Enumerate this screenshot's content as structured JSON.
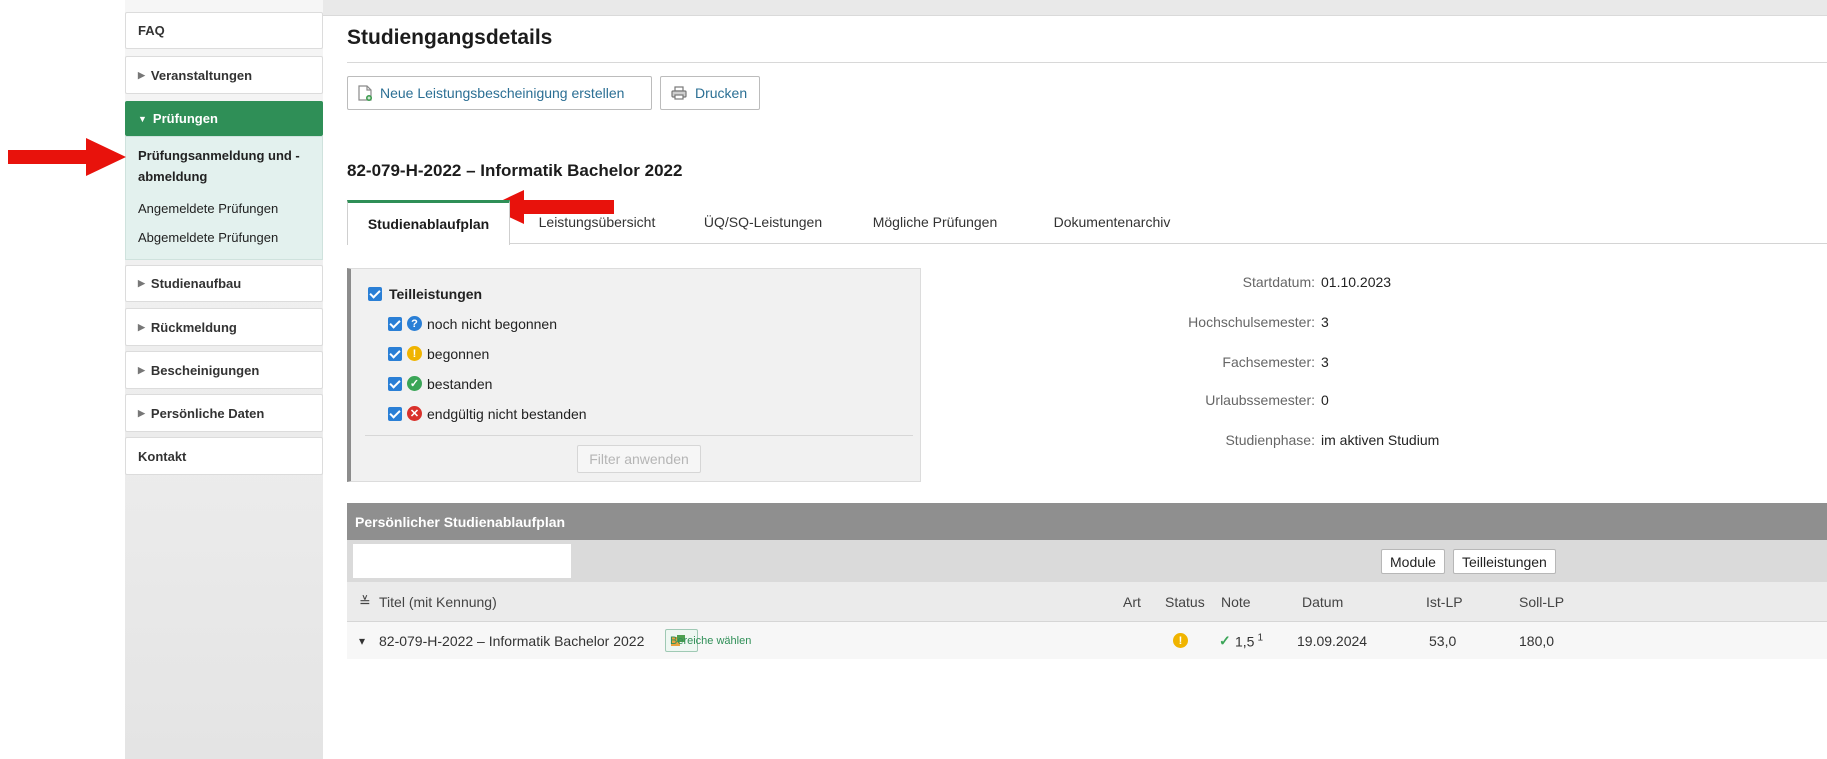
{
  "sidebar": {
    "faq": "FAQ",
    "veranstaltungen": "Veranstaltungen",
    "pruefungen": "Prüfungen",
    "sub": {
      "anmeldung": "Prüfungsanmeldung und -abmeldung",
      "angemeldete": "Angemeldete Prüfungen",
      "abgemeldete": "Abgemeldete Prüfungen"
    },
    "studienaufbau": "Studienaufbau",
    "rueckmeldung": "Rückmeldung",
    "bescheinigungen": "Bescheinigungen",
    "persoenliche_daten": "Persönliche Daten",
    "kontakt": "Kontakt"
  },
  "page": {
    "title": "Studiengangsdetails",
    "btn_new": "Neue Leistungsbescheinigung erstellen",
    "btn_print": "Drucken",
    "program_title": "82-079-H-2022 – Informatik Bachelor 2022"
  },
  "tabs": [
    "Studienablaufplan",
    "Leistungsübersicht",
    "ÜQ/SQ-Leistungen",
    "Mögliche Prüfungen",
    "Dokumentenarchiv"
  ],
  "filter": {
    "heading": "Teilleistungen",
    "options": [
      "noch nicht begonnen",
      "begonnen",
      "bestanden",
      "endgültig nicht bestanden"
    ],
    "apply": "Filter anwenden"
  },
  "info": {
    "start_label": "Startdatum:",
    "start_value": "01.10.2023",
    "hs_label": "Hochschulsemester:",
    "hs_value": "3",
    "fs_label": "Fachsemester:",
    "fs_value": "3",
    "us_label": "Urlaubssemester:",
    "us_value": "0",
    "phase_label": "Studienphase:",
    "phase_value": "im aktiven Studium"
  },
  "plan": {
    "header": "Persönlicher Studienablaufplan",
    "btn_module": "Module",
    "btn_teil": "Teilleistungen",
    "columns": {
      "titel": "Titel (mit Kennung)",
      "art": "Art",
      "status": "Status",
      "note": "Note",
      "datum": "Datum",
      "ist": "Ist-LP",
      "soll": "Soll-LP"
    },
    "row": {
      "title": "82-079-H-2022 – Informatik Bachelor 2022",
      "bereiche": "Bereiche wählen",
      "note": "1,5",
      "note_sup": "1",
      "datum": "19.09.2024",
      "ist": "53,0",
      "soll": "180,0"
    }
  },
  "colors": {
    "accent": "#2f8f57",
    "checkbox": "#2a7fd6",
    "annotation": "#e8120c"
  }
}
